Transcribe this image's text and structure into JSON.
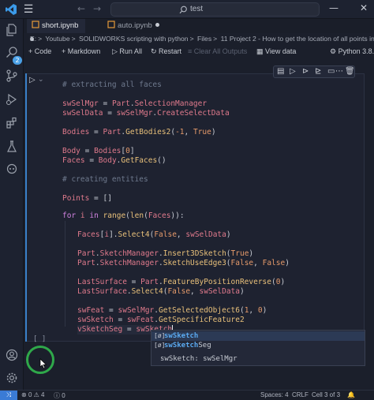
{
  "titlebar": {
    "search_text": "test"
  },
  "activity_badge": "2",
  "tabs": [
    {
      "label": "short.ipynb",
      "active": true
    },
    {
      "label": "auto.ipynb",
      "active": false
    }
  ],
  "breadcrumb": [
    "E:",
    "Youtube",
    "SOLIDWORKS scripting with python",
    "Files",
    "11 Project 2 - How to get the location of all points in a body"
  ],
  "toolbar": {
    "code": "Code",
    "markdown": "Markdown",
    "run_all": "Run All",
    "restart": "Restart",
    "clear_outputs": "Clear All Outputs",
    "view_data": "View data",
    "kernel": "Python 3.8.9"
  },
  "exec_count": "[ ]",
  "suggest": {
    "item1": {
      "match": "swSketch",
      "rest": ""
    },
    "item2": {
      "match": "swSketch",
      "rest": "Seg"
    },
    "detail": "swSketch: swSelMgr"
  },
  "status": {
    "errors": "0",
    "warnings": "4",
    "info": "0",
    "spaces": "Spaces: 4",
    "eol": "CRLF",
    "cell": "Cell 3 of 3"
  },
  "colors": {
    "accent": "#3a81c9",
    "cursor_ring": "#2fa84a"
  }
}
